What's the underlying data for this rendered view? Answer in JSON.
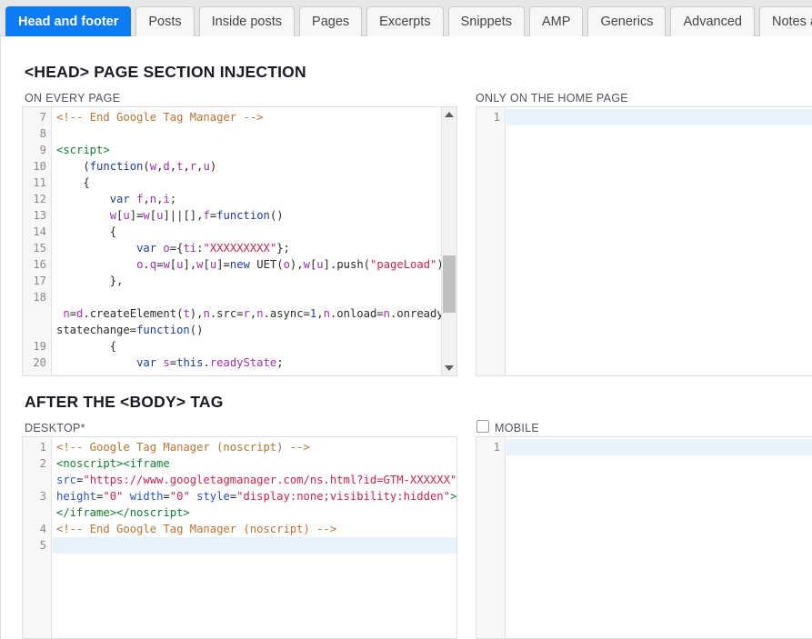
{
  "tabs": [
    {
      "label": "Head and footer",
      "active": true
    },
    {
      "label": "Posts",
      "active": false
    },
    {
      "label": "Inside posts",
      "active": false
    },
    {
      "label": "Pages",
      "active": false
    },
    {
      "label": "Excerpts",
      "active": false
    },
    {
      "label": "Snippets",
      "active": false
    },
    {
      "label": "AMP",
      "active": false
    },
    {
      "label": "Generics",
      "active": false
    },
    {
      "label": "Advanced",
      "active": false
    },
    {
      "label": "Notes and...",
      "active": false
    }
  ],
  "sections": {
    "head": {
      "title": "<HEAD> PAGE SECTION INJECTION",
      "left_label": "ON EVERY PAGE",
      "right_label": "ONLY ON THE HOME PAGE"
    },
    "body": {
      "title": "AFTER THE <BODY> TAG",
      "left_label": "DESKTOP*",
      "right_label": "MOBILE",
      "mobile_checked": false
    }
  },
  "colors": {
    "active_tab_bg": "#0d7cf2",
    "active_tab_text": "#ffffff",
    "tab_bar_bg": "#e7e7e7",
    "tab_bg": "#f7f7f7",
    "gutter_bg": "#f7f7f7",
    "active_line": "#e8f2fc",
    "comment": "#b87333",
    "tag": "#127d2e",
    "attribute": "#2a52be",
    "string": "#c7254e",
    "keyword": "#1f3d99",
    "variable": "#9b2fae"
  },
  "editors": {
    "head_every_page": {
      "first_line": 7,
      "scrollbar": {
        "visible": true,
        "thumb_top_pct": 56,
        "thumb_height_pct": 24
      },
      "lines": [
        {
          "num": "7",
          "tokens": [
            {
              "t": "com",
              "v": "<!-- End Google Tag Manager -->"
            }
          ]
        },
        {
          "num": "8",
          "tokens": []
        },
        {
          "num": "9",
          "tokens": [
            {
              "t": "tag",
              "v": "<script>"
            }
          ]
        },
        {
          "num": "10",
          "tokens": [
            {
              "t": "pln",
              "v": "    ("
            },
            {
              "t": "kw",
              "v": "function"
            },
            {
              "t": "pln",
              "v": "("
            },
            {
              "t": "var",
              "v": "w"
            },
            {
              "t": "pln",
              "v": ","
            },
            {
              "t": "var",
              "v": "d"
            },
            {
              "t": "pln",
              "v": ","
            },
            {
              "t": "var",
              "v": "t"
            },
            {
              "t": "pln",
              "v": ","
            },
            {
              "t": "var",
              "v": "r"
            },
            {
              "t": "pln",
              "v": ","
            },
            {
              "t": "var",
              "v": "u"
            },
            {
              "t": "pln",
              "v": ")"
            }
          ]
        },
        {
          "num": "11",
          "tokens": [
            {
              "t": "pln",
              "v": "    {"
            }
          ]
        },
        {
          "num": "12",
          "tokens": [
            {
              "t": "pln",
              "v": "        "
            },
            {
              "t": "kw",
              "v": "var"
            },
            {
              "t": "pln",
              "v": " "
            },
            {
              "t": "var",
              "v": "f"
            },
            {
              "t": "pln",
              "v": ","
            },
            {
              "t": "var",
              "v": "n"
            },
            {
              "t": "pln",
              "v": ","
            },
            {
              "t": "var",
              "v": "i"
            },
            {
              "t": "pln",
              "v": ";"
            }
          ]
        },
        {
          "num": "13",
          "tokens": [
            {
              "t": "pln",
              "v": "        "
            },
            {
              "t": "var",
              "v": "w"
            },
            {
              "t": "pln",
              "v": "["
            },
            {
              "t": "var",
              "v": "u"
            },
            {
              "t": "pln",
              "v": "]="
            },
            {
              "t": "var",
              "v": "w"
            },
            {
              "t": "pln",
              "v": "["
            },
            {
              "t": "var",
              "v": "u"
            },
            {
              "t": "pln",
              "v": "]||[],"
            },
            {
              "t": "var",
              "v": "f"
            },
            {
              "t": "pln",
              "v": "="
            },
            {
              "t": "kw",
              "v": "function"
            },
            {
              "t": "pln",
              "v": "()"
            }
          ]
        },
        {
          "num": "14",
          "tokens": [
            {
              "t": "pln",
              "v": "        {"
            }
          ]
        },
        {
          "num": "15",
          "tokens": [
            {
              "t": "pln",
              "v": "            "
            },
            {
              "t": "kw",
              "v": "var"
            },
            {
              "t": "pln",
              "v": " "
            },
            {
              "t": "var",
              "v": "o"
            },
            {
              "t": "pln",
              "v": "={"
            },
            {
              "t": "var",
              "v": "ti"
            },
            {
              "t": "pln",
              "v": ":"
            },
            {
              "t": "str",
              "v": "\"XXXXXXXXX\""
            },
            {
              "t": "pln",
              "v": "};"
            }
          ]
        },
        {
          "num": "16",
          "tokens": [
            {
              "t": "pln",
              "v": "            "
            },
            {
              "t": "var",
              "v": "o"
            },
            {
              "t": "pln",
              "v": "."
            },
            {
              "t": "var",
              "v": "q"
            },
            {
              "t": "pln",
              "v": "="
            },
            {
              "t": "var",
              "v": "w"
            },
            {
              "t": "pln",
              "v": "["
            },
            {
              "t": "var",
              "v": "u"
            },
            {
              "t": "pln",
              "v": "],"
            },
            {
              "t": "var",
              "v": "w"
            },
            {
              "t": "pln",
              "v": "["
            },
            {
              "t": "var",
              "v": "u"
            },
            {
              "t": "pln",
              "v": "]="
            },
            {
              "t": "kw",
              "v": "new"
            },
            {
              "t": "pln",
              "v": " UET("
            },
            {
              "t": "var",
              "v": "o"
            },
            {
              "t": "pln",
              "v": "),"
            },
            {
              "t": "var",
              "v": "w"
            },
            {
              "t": "pln",
              "v": "["
            },
            {
              "t": "var",
              "v": "u"
            },
            {
              "t": "pln",
              "v": "].push("
            },
            {
              "t": "str",
              "v": "\"pageLoad\""
            },
            {
              "t": "pln",
              "v": ")"
            }
          ]
        },
        {
          "num": "17",
          "tokens": [
            {
              "t": "pln",
              "v": "        },"
            }
          ]
        },
        {
          "num": "18",
          "tokens": []
        },
        {
          "num": "",
          "tokens": [
            {
              "t": "pln",
              "v": " "
            },
            {
              "t": "var",
              "v": "n"
            },
            {
              "t": "pln",
              "v": "="
            },
            {
              "t": "var",
              "v": "d"
            },
            {
              "t": "pln",
              "v": ".createElement("
            },
            {
              "t": "var",
              "v": "t"
            },
            {
              "t": "pln",
              "v": "),"
            },
            {
              "t": "var",
              "v": "n"
            },
            {
              "t": "pln",
              "v": ".src="
            },
            {
              "t": "var",
              "v": "r"
            },
            {
              "t": "pln",
              "v": ","
            },
            {
              "t": "var",
              "v": "n"
            },
            {
              "t": "pln",
              "v": ".async="
            },
            {
              "t": "num",
              "v": "1"
            },
            {
              "t": "pln",
              "v": ","
            },
            {
              "t": "var",
              "v": "n"
            },
            {
              "t": "pln",
              "v": ".onload="
            },
            {
              "t": "var",
              "v": "n"
            },
            {
              "t": "pln",
              "v": ".onready"
            }
          ]
        },
        {
          "num": "",
          "tokens": [
            {
              "t": "pln",
              "v": "statechange="
            },
            {
              "t": "kw",
              "v": "function"
            },
            {
              "t": "pln",
              "v": "()"
            }
          ]
        },
        {
          "num": "19",
          "tokens": [
            {
              "t": "pln",
              "v": "        {"
            }
          ]
        },
        {
          "num": "20",
          "tokens": [
            {
              "t": "pln",
              "v": "            "
            },
            {
              "t": "kw",
              "v": "var"
            },
            {
              "t": "pln",
              "v": " "
            },
            {
              "t": "var",
              "v": "s"
            },
            {
              "t": "pln",
              "v": "="
            },
            {
              "t": "kw",
              "v": "this"
            },
            {
              "t": "pln",
              "v": "."
            },
            {
              "t": "var",
              "v": "readyState"
            },
            {
              "t": "pln",
              "v": ";"
            }
          ]
        }
      ]
    },
    "head_home_page": {
      "lines": [
        {
          "num": "1",
          "tokens": [],
          "highlight": true
        }
      ]
    },
    "body_desktop": {
      "lines": [
        {
          "num": "1",
          "tokens": [
            {
              "t": "com",
              "v": "<!-- Google Tag Manager (noscript) -->"
            }
          ]
        },
        {
          "num": "2",
          "tokens": [
            {
              "t": "tag",
              "v": "<noscript><iframe"
            }
          ]
        },
        {
          "num": "",
          "tokens": [
            {
              "t": "attr",
              "v": "src"
            },
            {
              "t": "pln",
              "v": "="
            },
            {
              "t": "str",
              "v": "\"https://www.googletagmanager.com/ns.html?id=GTM-XXXXXX\""
            }
          ]
        },
        {
          "num": "3",
          "tokens": [
            {
              "t": "attr",
              "v": "height"
            },
            {
              "t": "pln",
              "v": "="
            },
            {
              "t": "str",
              "v": "\"0\""
            },
            {
              "t": "pln",
              "v": " "
            },
            {
              "t": "attr",
              "v": "width"
            },
            {
              "t": "pln",
              "v": "="
            },
            {
              "t": "str",
              "v": "\"0\""
            },
            {
              "t": "pln",
              "v": " "
            },
            {
              "t": "attr",
              "v": "style"
            },
            {
              "t": "pln",
              "v": "="
            },
            {
              "t": "str",
              "v": "\"display:none;visibility:hidden\""
            },
            {
              "t": "tag",
              "v": ">"
            }
          ]
        },
        {
          "num": "",
          "tokens": [
            {
              "t": "tag",
              "v": "</iframe></noscript>"
            }
          ]
        },
        {
          "num": "4",
          "tokens": [
            {
              "t": "com",
              "v": "<!-- End Google Tag Manager (noscript) -->"
            }
          ]
        },
        {
          "num": "5",
          "tokens": [],
          "highlight": true
        }
      ]
    },
    "body_mobile": {
      "lines": [
        {
          "num": "1",
          "tokens": [],
          "highlight": true
        }
      ]
    }
  }
}
